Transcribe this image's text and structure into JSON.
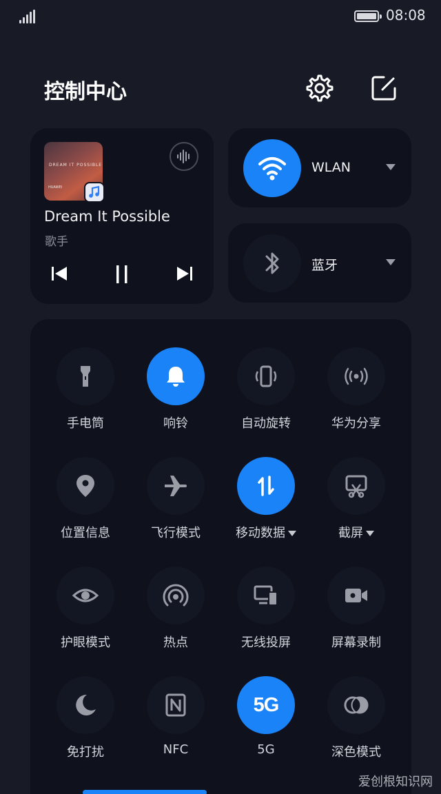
{
  "status": {
    "time": "08:08",
    "signal_icon": "signal-bars-icon",
    "battery_icon": "battery-icon"
  },
  "header": {
    "title": "控制中心",
    "settings_icon": "gear-icon",
    "edit_icon": "edit-icon"
  },
  "media": {
    "album_title": "DREAM IT POSSIBLE",
    "album_brand": "HUAWEI",
    "song": "Dream It Possible",
    "artist": "歌手",
    "app_icon": "music-app-icon",
    "audio_output_icon": "audio-wave-icon",
    "controls": [
      "previous-icon",
      "pause-icon",
      "next-icon"
    ]
  },
  "connectivity": {
    "wlan": {
      "label": "WLAN",
      "on": true,
      "icon": "wifi-icon"
    },
    "bluetooth": {
      "label": "蓝牙",
      "on": false,
      "icon": "bluetooth-icon"
    }
  },
  "toggles": [
    {
      "label": "手电筒",
      "icon": "flashlight-icon",
      "on": false,
      "dropdown": false
    },
    {
      "label": "响铃",
      "icon": "bell-icon",
      "on": true,
      "dropdown": false
    },
    {
      "label": "自动旋转",
      "icon": "auto-rotate-icon",
      "on": false,
      "dropdown": false
    },
    {
      "label": "华为分享",
      "icon": "share-icon",
      "on": false,
      "dropdown": false
    },
    {
      "label": "位置信息",
      "icon": "location-icon",
      "on": false,
      "dropdown": false
    },
    {
      "label": "飞行模式",
      "icon": "airplane-icon",
      "on": false,
      "dropdown": false
    },
    {
      "label": "移动数据",
      "icon": "mobile-data-icon",
      "on": true,
      "dropdown": true
    },
    {
      "label": "截屏",
      "icon": "screenshot-icon",
      "on": false,
      "dropdown": true
    },
    {
      "label": "护眼模式",
      "icon": "eye-icon",
      "on": false,
      "dropdown": false
    },
    {
      "label": "热点",
      "icon": "hotspot-icon",
      "on": false,
      "dropdown": false
    },
    {
      "label": "无线投屏",
      "icon": "screen-cast-icon",
      "on": false,
      "dropdown": false
    },
    {
      "label": "屏幕录制",
      "icon": "screen-record-icon",
      "on": false,
      "dropdown": false
    },
    {
      "label": "免打扰",
      "icon": "moon-icon",
      "on": false,
      "dropdown": false
    },
    {
      "label": "NFC",
      "icon": "nfc-icon",
      "on": false,
      "dropdown": false
    },
    {
      "label": "5G",
      "icon": "5g-icon",
      "icon_text": "5G",
      "on": true,
      "dropdown": false
    },
    {
      "label": "深色模式",
      "icon": "dark-mode-icon",
      "on": false,
      "dropdown": false
    }
  ],
  "colors": {
    "accent": "#1a83f7",
    "background": "#181b26",
    "card": "#0f121c"
  },
  "watermark": "爱创根知识网"
}
